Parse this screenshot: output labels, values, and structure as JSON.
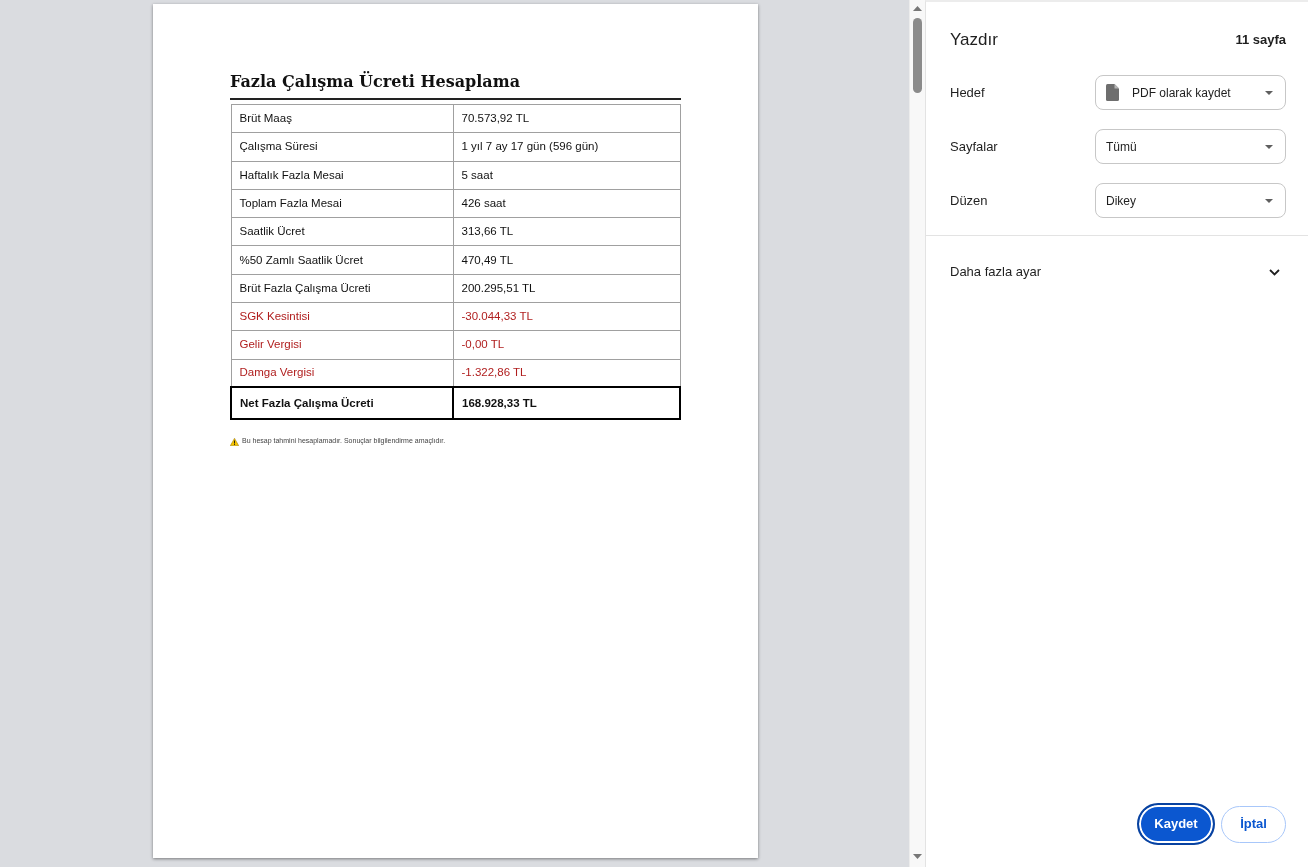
{
  "print_preview": {
    "page": {
      "title": "Fazla Çalışma Ücreti Hesaplama",
      "rows": [
        {
          "label": "Brüt Maaş",
          "value": "70.573,92 TL",
          "kind": "item"
        },
        {
          "label": "Çalışma Süresi",
          "value": "1 yıl 7 ay 17 gün (596 gün)",
          "kind": "item"
        },
        {
          "label": "Haftalık Fazla Mesai",
          "value": "5 saat",
          "kind": "item"
        },
        {
          "label": "Toplam Fazla Mesai",
          "value": "426 saat",
          "kind": "item"
        },
        {
          "label": "Saatlik Ücret",
          "value": "313,66 TL",
          "kind": "item"
        },
        {
          "label": "%50 Zamlı Saatlik Ücret",
          "value": "470,49 TL",
          "kind": "item"
        },
        {
          "label": "Brüt Fazla Çalışma Ücreti",
          "value": "200.295,51 TL",
          "kind": "item"
        },
        {
          "label": "SGK Kesintisi",
          "value": "-30.044,33 TL",
          "kind": "deduction"
        },
        {
          "label": "Gelir Vergisi",
          "value": "-0,00 TL",
          "kind": "deduction"
        },
        {
          "label": "Damga Vergisi",
          "value": "-1.322,86 TL",
          "kind": "deduction"
        },
        {
          "label": "Net Fazla Çalışma Ücreti",
          "value": "168.928,33 TL",
          "kind": "total"
        }
      ],
      "note": "Bu hesap tahmini hesaplamadır. Sonuçlar bilgilendirme amaçlıdır."
    }
  },
  "print_panel": {
    "title": "Yazdır",
    "page_count": "11 sayfa",
    "settings": [
      {
        "label": "Hedef",
        "value": "PDF olarak kaydet",
        "kind": "destination"
      },
      {
        "label": "Sayfalar",
        "value": "Tümü",
        "kind": "dropdown"
      },
      {
        "label": "Düzen",
        "value": "Dikey",
        "kind": "dropdown"
      }
    ],
    "more_settings": {
      "label": "Daha fazla ayar",
      "expanded": false
    },
    "buttons": [
      {
        "label": "Kaydet",
        "kind": "primary"
      },
      {
        "label": "İptal",
        "kind": "secondary"
      }
    ]
  }
}
